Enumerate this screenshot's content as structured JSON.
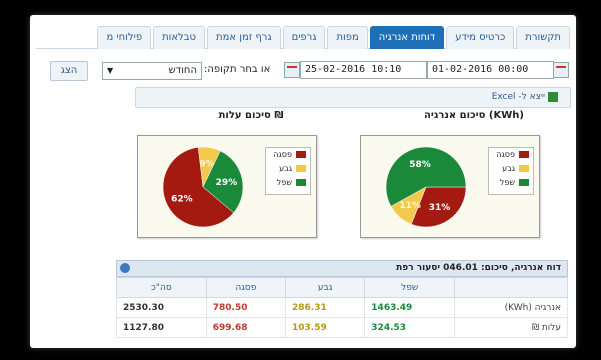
{
  "tabs": [
    {
      "label": "תקשורת",
      "active": false
    },
    {
      "label": "כרטיס מידע",
      "active": false
    },
    {
      "label": "דוחות אנרגיה",
      "active": true
    },
    {
      "label": "מפות",
      "active": false
    },
    {
      "label": "גרפים",
      "active": false
    },
    {
      "label": "גרף זמן אמת",
      "active": false
    },
    {
      "label": "טבלאות",
      "active": false
    },
    {
      "label": "פילוחי מ",
      "active": false
    }
  ],
  "filter": {
    "date_from": "01-02-2016 00:00",
    "date_to": "25-02-2016 10:10",
    "period_label": "או בחר תקופה:",
    "period_value": "החודש",
    "show_button": "הצג"
  },
  "export_label": "ייצא ל- Excel",
  "colors": {
    "peak": "#a51a10",
    "shoulder": "#f2c94c",
    "offpeak": "#1a8a3a",
    "accent": "#1f6fb6"
  },
  "chart_data": [
    {
      "type": "pie",
      "title": "סיכום אנרגיה (KWh)",
      "categories": [
        "פסגה",
        "גבע",
        "שפל"
      ],
      "values": [
        31,
        11,
        58
      ],
      "labels": [
        "31%",
        "11%",
        "58%"
      ]
    },
    {
      "type": "pie",
      "title": "סיכום עלות ₪",
      "categories": [
        "פסגה",
        "גבע",
        "שפל"
      ],
      "values": [
        62,
        9,
        29
      ],
      "labels": [
        "62%",
        "9%",
        "29%"
      ]
    }
  ],
  "table": {
    "title": "דוח אנרגיה, סיכום: 046.01 יסעור רפת",
    "headers": [
      "",
      "שפל",
      "גבע",
      "פסגה",
      "סה\"כ"
    ],
    "rows": [
      {
        "label": "אנרגיה (KWh)",
        "offpeak": "1463.49",
        "shoulder": "286.31",
        "peak": "780.50",
        "total": "2530.30"
      },
      {
        "label": "עלות ₪",
        "offpeak": "324.53",
        "shoulder": "103.59",
        "peak": "699.68",
        "total": "1127.80"
      }
    ]
  }
}
